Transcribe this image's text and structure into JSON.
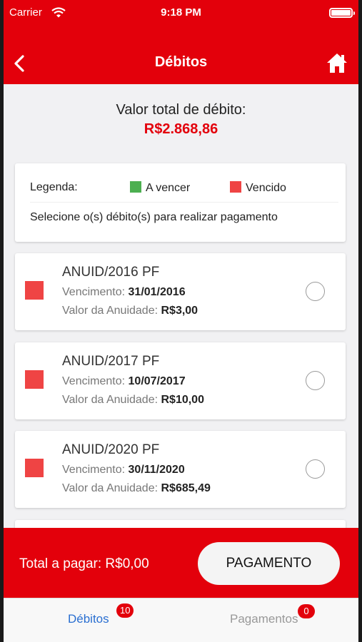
{
  "status_bar": {
    "carrier": "Carrier",
    "time": "9:18 PM"
  },
  "nav": {
    "title": "Débitos",
    "back_icon": "chevron-left-icon",
    "home_icon": "home-icon"
  },
  "summary": {
    "label": "Valor total de débito:",
    "value": "R$2.868,86"
  },
  "legend": {
    "label": "Legenda:",
    "items": [
      {
        "label": "A vencer",
        "color": "#4caf50"
      },
      {
        "label": "Vencido",
        "color": "#ef4444"
      }
    ],
    "instruction": "Selecione o(s) débito(s) para realizar pagamento"
  },
  "debits": [
    {
      "title": "ANUID/2016 PF",
      "due_label": "Vencimento:",
      "due": "31/01/2016",
      "amount_label": "Valor da Anuidade:",
      "amount": "R$3,00",
      "status": "Vencido"
    },
    {
      "title": "ANUID/2017 PF",
      "due_label": "Vencimento:",
      "due": "10/07/2017",
      "amount_label": "Valor da Anuidade:",
      "amount": "R$10,00",
      "status": "Vencido"
    },
    {
      "title": "ANUID/2020 PF",
      "due_label": "Vencimento:",
      "due": "30/11/2020",
      "amount_label": "Valor da Anuidade:",
      "amount": "R$685,49",
      "status": "Vencido"
    }
  ],
  "payment": {
    "total_label": "Total a pagar:",
    "total_value": "R$0,00",
    "button_label": "PAGAMENTO"
  },
  "tabs": [
    {
      "label": "Débitos",
      "badge": "10",
      "active": true
    },
    {
      "label": "Pagamentos",
      "badge": "0",
      "active": false
    }
  ],
  "colors": {
    "brand_red": "#e3000b",
    "overdue": "#ef4444",
    "upcoming": "#4caf50",
    "active_tab": "#2a6fd1"
  }
}
